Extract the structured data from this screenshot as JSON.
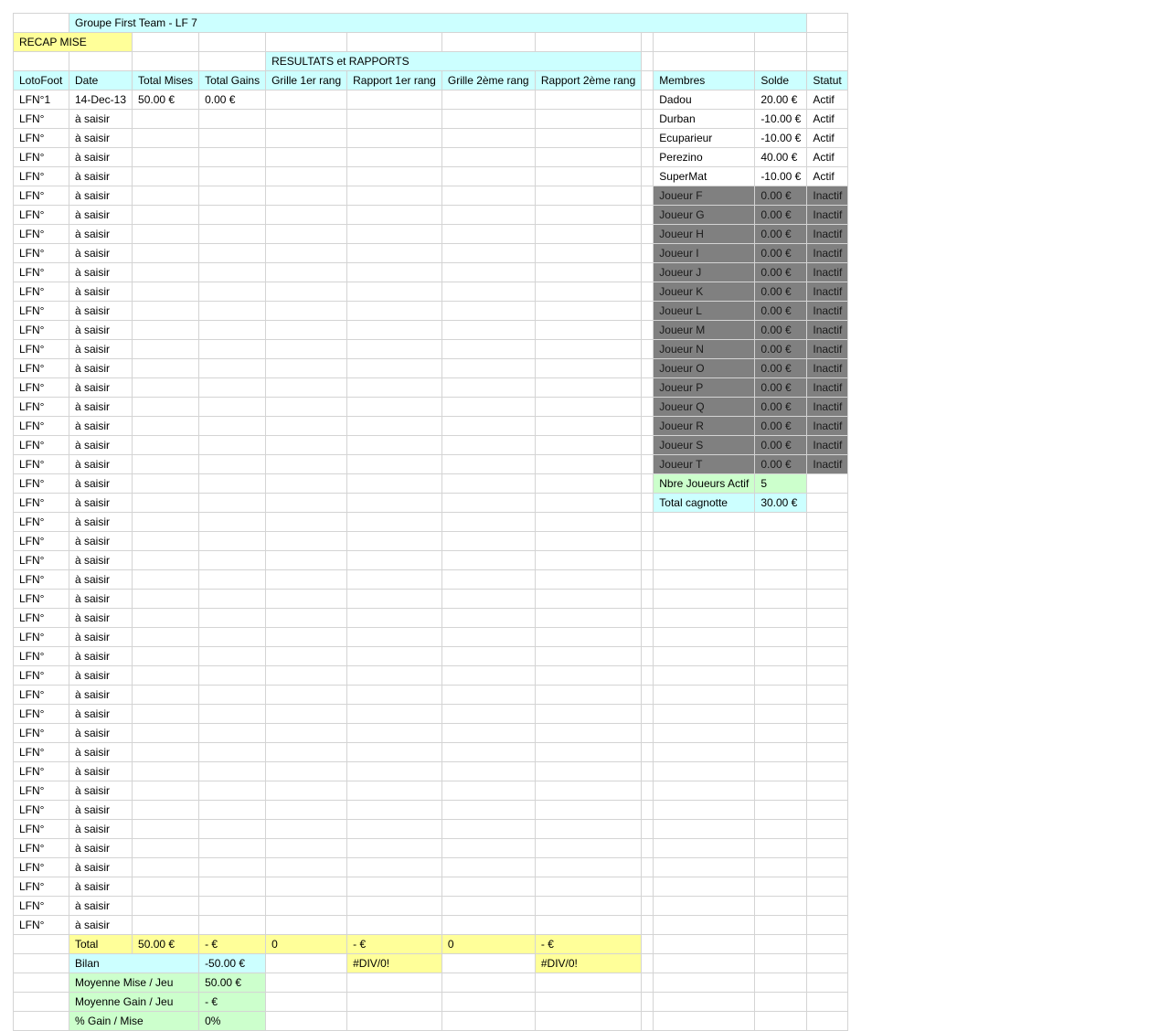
{
  "title": "Groupe First Team - LF 7",
  "recap_label": "RECAP MISE",
  "resultats_label": "RESULTATS et RAPPORTS",
  "headers": [
    "LotoFoot",
    "Date",
    "Total Mises",
    "Total Gains",
    "Grille 1er rang",
    "Rapport 1er rang",
    "Grille 2ème rang",
    "Rapport 2ème rang"
  ],
  "members_headers": [
    "Membres",
    "Solde",
    "Statut"
  ],
  "games": [
    [
      "LFN°1",
      "14-Dec-13",
      "50.00 €",
      "0.00 €"
    ],
    [
      "LFN°",
      "à saisir"
    ],
    [
      "LFN°",
      "à saisir"
    ],
    [
      "LFN°",
      "à saisir"
    ],
    [
      "LFN°",
      "à saisir"
    ],
    [
      "LFN°",
      "à saisir"
    ],
    [
      "LFN°",
      "à saisir"
    ],
    [
      "LFN°",
      "à saisir"
    ],
    [
      "LFN°",
      "à saisir"
    ],
    [
      "LFN°",
      "à saisir"
    ],
    [
      "LFN°",
      "à saisir"
    ],
    [
      "LFN°",
      "à saisir"
    ],
    [
      "LFN°",
      "à saisir"
    ],
    [
      "LFN°",
      "à saisir"
    ],
    [
      "LFN°",
      "à saisir"
    ],
    [
      "LFN°",
      "à saisir"
    ],
    [
      "LFN°",
      "à saisir"
    ],
    [
      "LFN°",
      "à saisir"
    ],
    [
      "LFN°",
      "à saisir"
    ],
    [
      "LFN°",
      "à saisir"
    ],
    [
      "LFN°",
      "à saisir"
    ],
    [
      "LFN°",
      "à saisir"
    ],
    [
      "LFN°",
      "à saisir"
    ],
    [
      "LFN°",
      "à saisir"
    ],
    [
      "LFN°",
      "à saisir"
    ],
    [
      "LFN°",
      "à saisir"
    ],
    [
      "LFN°",
      "à saisir"
    ],
    [
      "LFN°",
      "à saisir"
    ],
    [
      "LFN°",
      "à saisir"
    ],
    [
      "LFN°",
      "à saisir"
    ],
    [
      "LFN°",
      "à saisir"
    ],
    [
      "LFN°",
      "à saisir"
    ],
    [
      "LFN°",
      "à saisir"
    ],
    [
      "LFN°",
      "à saisir"
    ],
    [
      "LFN°",
      "à saisir"
    ],
    [
      "LFN°",
      "à saisir"
    ],
    [
      "LFN°",
      "à saisir"
    ],
    [
      "LFN°",
      "à saisir"
    ],
    [
      "LFN°",
      "à saisir"
    ],
    [
      "LFN°",
      "à saisir"
    ],
    [
      "LFN°",
      "à saisir"
    ],
    [
      "LFN°",
      "à saisir"
    ],
    [
      "LFN°",
      "à saisir"
    ],
    [
      "LFN°",
      "à saisir"
    ]
  ],
  "members": [
    {
      "name": "Dadou",
      "solde": "20.00 €",
      "statut": "Actif",
      "active": true
    },
    {
      "name": "Durban",
      "solde": "-10.00 €",
      "statut": "Actif",
      "active": true
    },
    {
      "name": "Ecuparieur",
      "solde": "-10.00 €",
      "statut": "Actif",
      "active": true
    },
    {
      "name": "Perezino",
      "solde": "40.00 €",
      "statut": "Actif",
      "active": true
    },
    {
      "name": "SuperMat",
      "solde": "-10.00 €",
      "statut": "Actif",
      "active": true
    },
    {
      "name": "Joueur F",
      "solde": "0.00 €",
      "statut": "Inactif",
      "active": false
    },
    {
      "name": "Joueur G",
      "solde": "0.00 €",
      "statut": "Inactif",
      "active": false
    },
    {
      "name": "Joueur H",
      "solde": "0.00 €",
      "statut": "Inactif",
      "active": false
    },
    {
      "name": "Joueur I",
      "solde": "0.00 €",
      "statut": "Inactif",
      "active": false
    },
    {
      "name": "Joueur J",
      "solde": "0.00 €",
      "statut": "Inactif",
      "active": false
    },
    {
      "name": "Joueur K",
      "solde": "0.00 €",
      "statut": "Inactif",
      "active": false
    },
    {
      "name": "Joueur L",
      "solde": "0.00 €",
      "statut": "Inactif",
      "active": false
    },
    {
      "name": "Joueur M",
      "solde": "0.00 €",
      "statut": "Inactif",
      "active": false
    },
    {
      "name": "Joueur N",
      "solde": "0.00 €",
      "statut": "Inactif",
      "active": false
    },
    {
      "name": "Joueur O",
      "solde": "0.00 €",
      "statut": "Inactif",
      "active": false
    },
    {
      "name": "Joueur P",
      "solde": "0.00 €",
      "statut": "Inactif",
      "active": false
    },
    {
      "name": "Joueur Q",
      "solde": "0.00 €",
      "statut": "Inactif",
      "active": false
    },
    {
      "name": "Joueur R",
      "solde": "0.00 €",
      "statut": "Inactif",
      "active": false
    },
    {
      "name": "Joueur S",
      "solde": "0.00 €",
      "statut": "Inactif",
      "active": false
    },
    {
      "name": "Joueur T",
      "solde": "0.00 €",
      "statut": "Inactif",
      "active": false
    }
  ],
  "summary_members": [
    {
      "label": "Nbre Joueurs Actif",
      "value": "5",
      "color": "green"
    },
    {
      "label": "Total cagnotte",
      "value": "30.00 €",
      "color": "cyan"
    }
  ],
  "totals": {
    "label": "Total",
    "cells": [
      "50.00 €",
      "- €",
      "0",
      "- €",
      "0",
      "- €"
    ]
  },
  "bilan": {
    "label": "Bilan",
    "value": "-50.00 €",
    "rapport1": "#DIV/0!",
    "rapport2": "#DIV/0!"
  },
  "stats": [
    {
      "label": "Moyenne Mise / Jeu",
      "value": "50.00 €"
    },
    {
      "label": "Moyenne Gain / Jeu",
      "value": "- €"
    },
    {
      "label": "% Gain / Mise",
      "value": "0%"
    }
  ],
  "colors": {
    "cyan": "#ccffff",
    "yellow": "#ffff99",
    "green": "#ccffcc",
    "grey": "#808080"
  }
}
